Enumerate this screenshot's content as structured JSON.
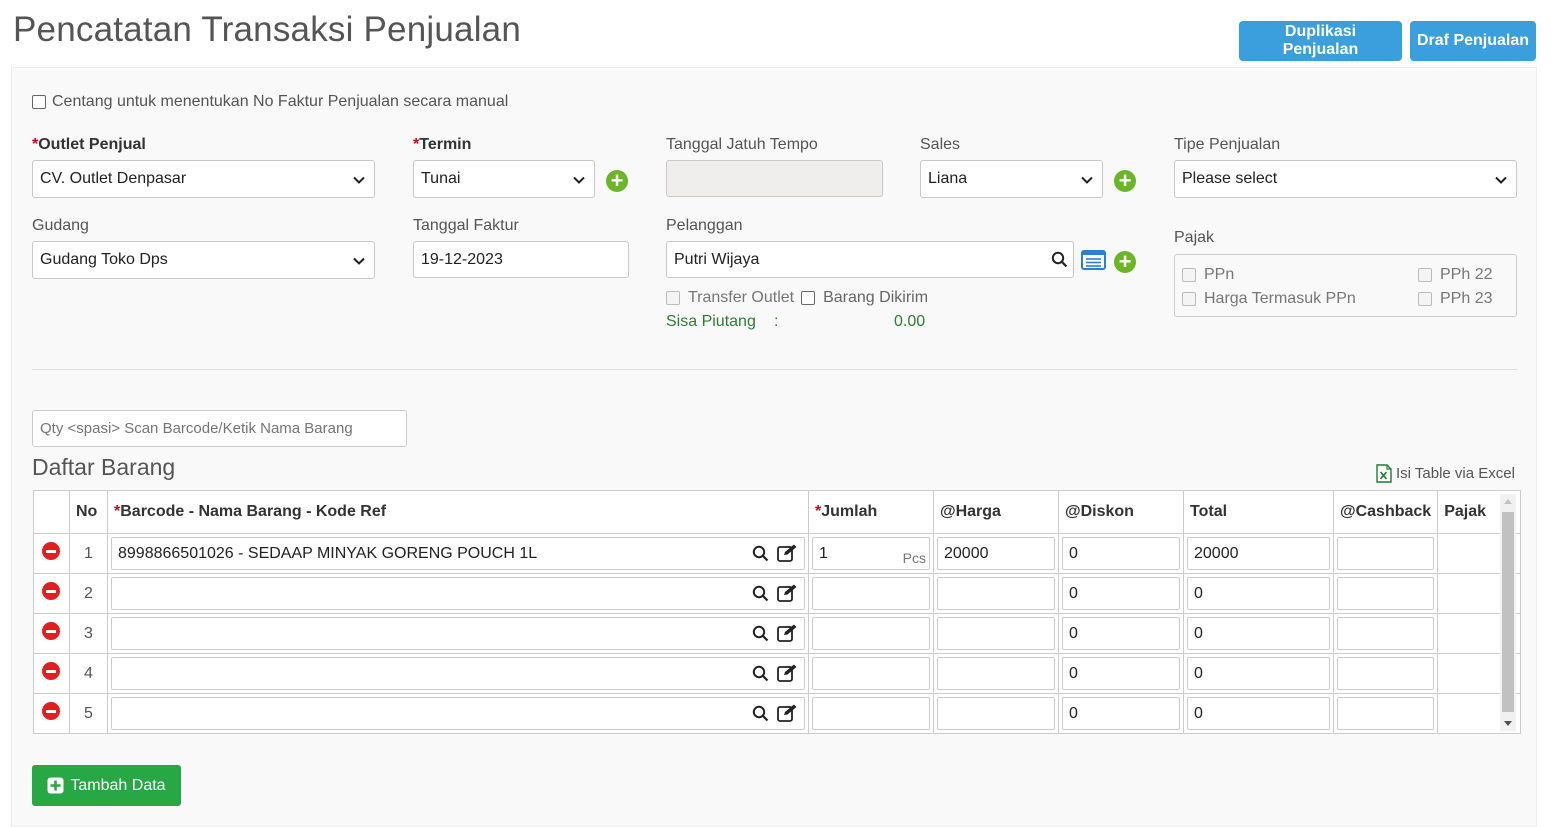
{
  "header": {
    "title": "Pencatatan Transaksi Penjualan",
    "dup_label": "Duplikasi Penjualan",
    "draft_label": "Draf Penjualan"
  },
  "form": {
    "manual_invoice_label": "Centang untuk menentukan No Faktur Penjualan secara manual",
    "outlet_label": "Outlet Penjual",
    "outlet_value": "CV. Outlet Denpasar",
    "termin_label": "Termin",
    "termin_value": "Tunai",
    "due_label": "Tanggal Jatuh Tempo",
    "sales_label": "Sales",
    "sales_value": "Liana",
    "type_label": "Tipe Penjualan",
    "type_value": "Please select",
    "warehouse_label": "Gudang",
    "warehouse_value": "Gudang Toko Dps",
    "invoice_date_label": "Tanggal Faktur",
    "invoice_date_value": "19-12-2023",
    "customer_label": "Pelanggan",
    "customer_value": "Putri Wijaya",
    "transfer_label": "Transfer Outlet",
    "shipped_label": "Barang Dikirim",
    "receivable_label": "Sisa Piutang",
    "receivable_sep": ":",
    "receivable_value": "0.00",
    "tax_label": "Pajak",
    "tax_ppn": "PPn",
    "tax_incl": "Harga Termasuk PPn",
    "tax_pph22": "PPh 22",
    "tax_pph23": "PPh 23",
    "required_mark": "*"
  },
  "items": {
    "scan_placeholder": "Qty <spasi> Scan Barcode/Ketik Nama Barang",
    "section_title": "Daftar Barang",
    "excel_label": "Isi Table via Excel",
    "columns": {
      "no": "No",
      "barcode": "Barcode - Nama Barang - Kode Ref",
      "qty": "Jumlah",
      "price": "@Harga",
      "discount": "@Diskon",
      "total": "Total",
      "cashback": "@Cashback",
      "tax": "Pajak"
    },
    "rows": [
      {
        "no": "1",
        "barcode": "8998866501026 - SEDAAP MINYAK GORENG POUCH 1L",
        "qty": "1",
        "unit": "Pcs",
        "price": "20000",
        "discount": "0",
        "total": "20000",
        "cashback": ""
      },
      {
        "no": "2",
        "barcode": "",
        "qty": "",
        "unit": "",
        "price": "",
        "discount": "0",
        "total": "0",
        "cashback": ""
      },
      {
        "no": "3",
        "barcode": "",
        "qty": "",
        "unit": "",
        "price": "",
        "discount": "0",
        "total": "0",
        "cashback": ""
      },
      {
        "no": "4",
        "barcode": "",
        "qty": "",
        "unit": "",
        "price": "",
        "discount": "0",
        "total": "0",
        "cashback": ""
      },
      {
        "no": "5",
        "barcode": "",
        "qty": "",
        "unit": "",
        "price": "",
        "discount": "0",
        "total": "0",
        "cashback": ""
      }
    ],
    "add_label": "Tambah Data"
  },
  "colors": {
    "primary_button": "#3a9fdc",
    "success_button": "#28a745",
    "add_icon": "#6bb526",
    "remove_icon": "#e02020",
    "required": "#d0021b",
    "receivable_text": "#2e7d32"
  }
}
